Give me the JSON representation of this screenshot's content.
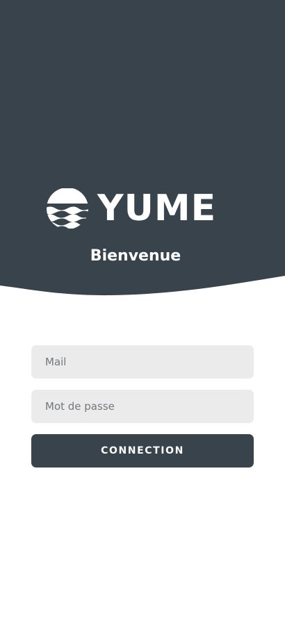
{
  "colors": {
    "header_bg": "#39434b",
    "field_bg": "#ebebeb",
    "button_bg": "#39434b",
    "text_on_dark": "#ffffff",
    "placeholder": "#74777b"
  },
  "header": {
    "logo_icon": "sun-waves-icon",
    "brand": "YUME",
    "welcome": "Bienvenue"
  },
  "form": {
    "mail_placeholder": "Mail",
    "password_placeholder": "Mot de passe",
    "connect_label": "CONNECTION"
  }
}
